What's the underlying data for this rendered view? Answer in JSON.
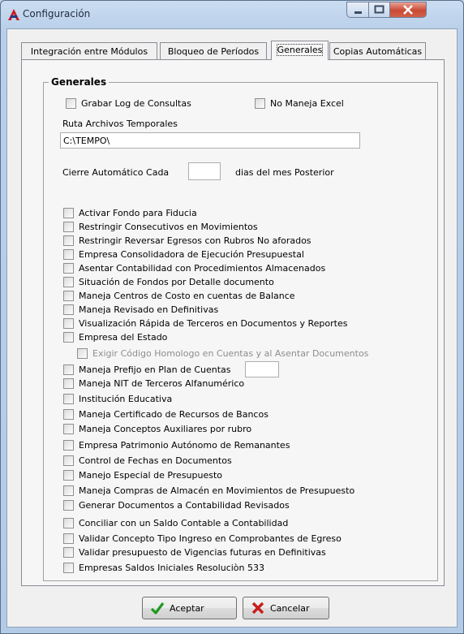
{
  "window": {
    "title": "Configuración"
  },
  "tabs": [
    {
      "label": "Integración entre Módulos"
    },
    {
      "label": "Bloqueo de Períodos"
    },
    {
      "label": "Generales"
    },
    {
      "label": "Copias Automáticas"
    }
  ],
  "active_tab": "Generales",
  "group": {
    "title": "Generales"
  },
  "top_options": {
    "grabar_log": {
      "label": "Grabar Log de Consultas",
      "checked": false
    },
    "no_excel": {
      "label": "No Maneja Excel",
      "checked": false
    }
  },
  "ruta": {
    "label": "Ruta Archivos Temporales",
    "value": "C:\\TEMPO\\"
  },
  "cierre": {
    "label_before": "Cierre Automático Cada",
    "value": "",
    "label_after": "dias del mes Posterior"
  },
  "options": [
    "Activar Fondo para Fiducia",
    "Restringir Consecutivos en Movimientos",
    "Restringir Reversar Egresos con Rubros No aforados",
    "Empresa Consolidadora de Ejecución Presupuestal",
    "Asentar Contabilidad con Procedimientos Almacenados",
    "Situación de Fondos por Detalle documento",
    "Maneja Centros de Costo en cuentas de Balance",
    "Maneja Revisado en Definitivas",
    "Visualización Rápida de Terceros en Documentos y Reportes",
    "Empresa del Estado",
    "Exigir Código Homologo en Cuentas y al Asentar Documentos",
    "Maneja Prefijo en Plan de Cuentas",
    "Maneja NIT de Terceros Alfanumérico",
    "Institución Educativa",
    "Maneja Certificado de Recursos de Bancos",
    "Maneja Conceptos Auxiliares por rubro",
    "Empresa Patrimonio Autónomo de Remanantes",
    "Control de Fechas en Documentos",
    "Manejo Especial de Presupuesto",
    "Maneja Compras de Almacén en Movimientos de Presupuesto",
    "Generar Documentos a Contabilidad Revisados",
    "Conciliar con un Saldo Contable a Contabilidad",
    "Validar Concepto Tipo Ingreso en Comprobantes de Egreso",
    "Validar presupuesto de Vigencias futuras en Definitivas",
    "Empresas Saldos Iniciales Resoluciòn 533"
  ],
  "disabled_option": "Exigir Código Homologo en Cuentas y al Asentar Documentos",
  "buttons": {
    "accept": "Aceptar",
    "cancel": "Cancelar"
  },
  "icons": {
    "window_close": "close-icon",
    "accept": "checkmark-icon",
    "cancel": "x-icon"
  },
  "colors": {
    "accept_icon": "#1e9a1e",
    "cancel_icon": "#c81d1d",
    "close_button": "#c94a34"
  }
}
